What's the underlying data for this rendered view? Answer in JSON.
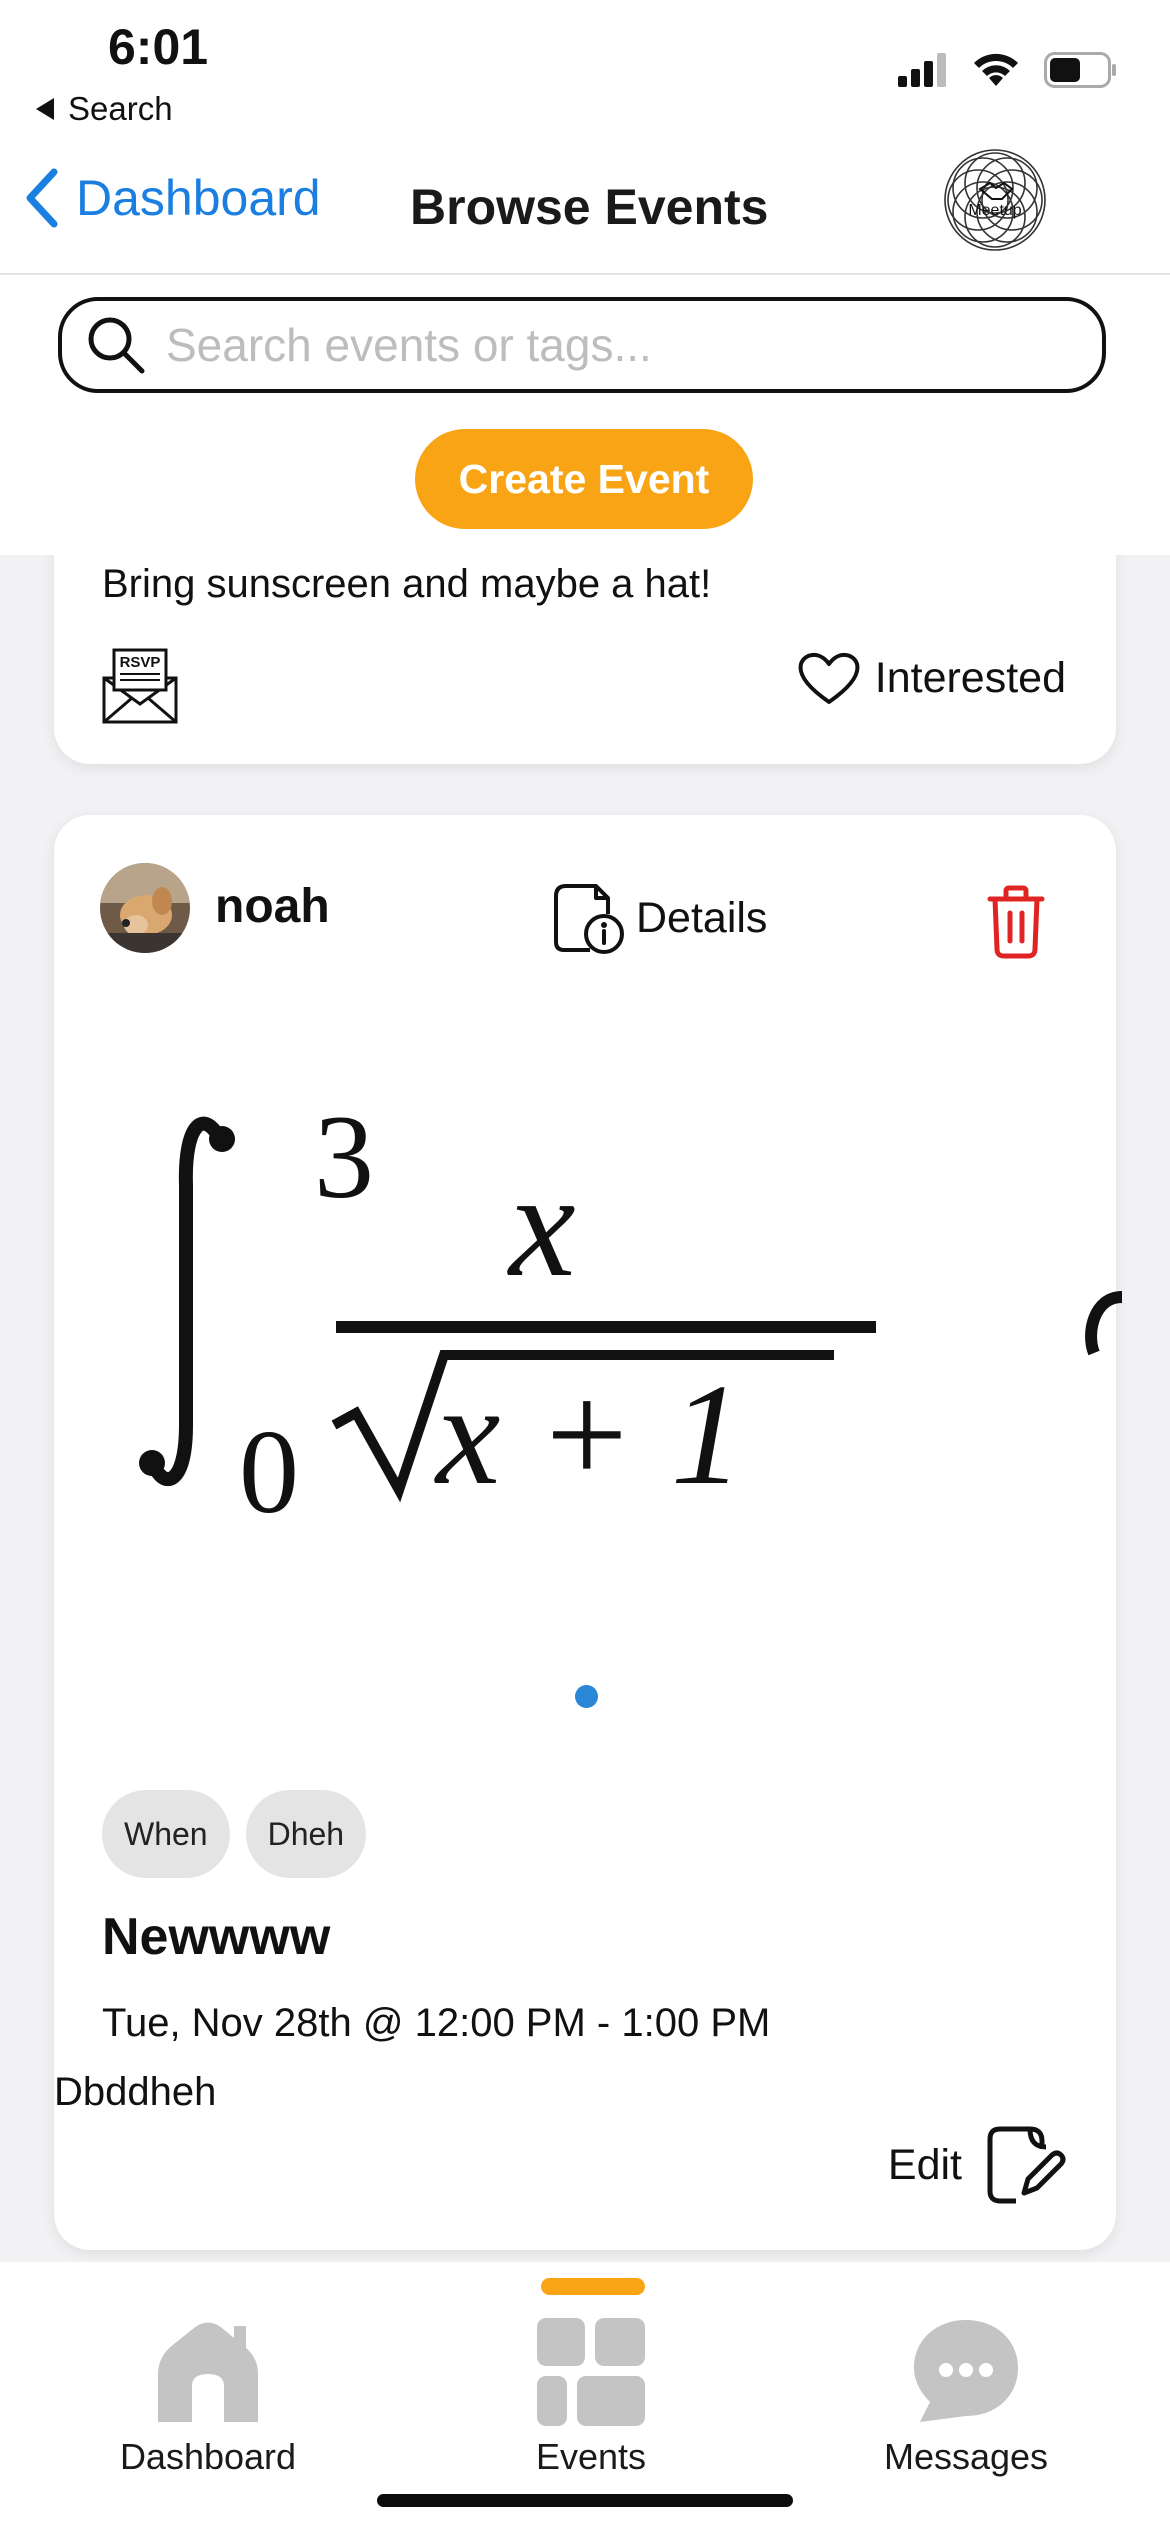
{
  "status_bar": {
    "time": "6:01",
    "back_app": "Search"
  },
  "nav": {
    "back_label": "Dashboard",
    "title": "Browse Events",
    "logo_text": "Meetup"
  },
  "search": {
    "placeholder": "Search events or tags..."
  },
  "create_button": "Create Event",
  "events": [
    {
      "description": "Bring sunscreen and maybe a hat!",
      "rsvp_icon_text": "RSVP",
      "interested_label": "Interested"
    },
    {
      "username": "noah",
      "details_label": "Details",
      "formula": {
        "upper": "3",
        "lower": "0",
        "numerator": "x",
        "denominator": "x + 1"
      },
      "tags": [
        "When",
        "Dheh"
      ],
      "title": "Newwww",
      "time": "Tue, Nov 28th @ 12:00 PM - 1:00 PM",
      "description": "Dbddheh",
      "edit_label": "Edit"
    }
  ],
  "tabs": [
    {
      "label": "Dashboard",
      "icon": "home-icon"
    },
    {
      "label": "Events",
      "icon": "grid-icon",
      "active": true
    },
    {
      "label": "Messages",
      "icon": "chat-bubble-icon"
    }
  ],
  "colors": {
    "accent": "#f8a415",
    "link": "#1a7fe0",
    "delete": "#e02424",
    "tab_icon": "#c4c4c4"
  }
}
